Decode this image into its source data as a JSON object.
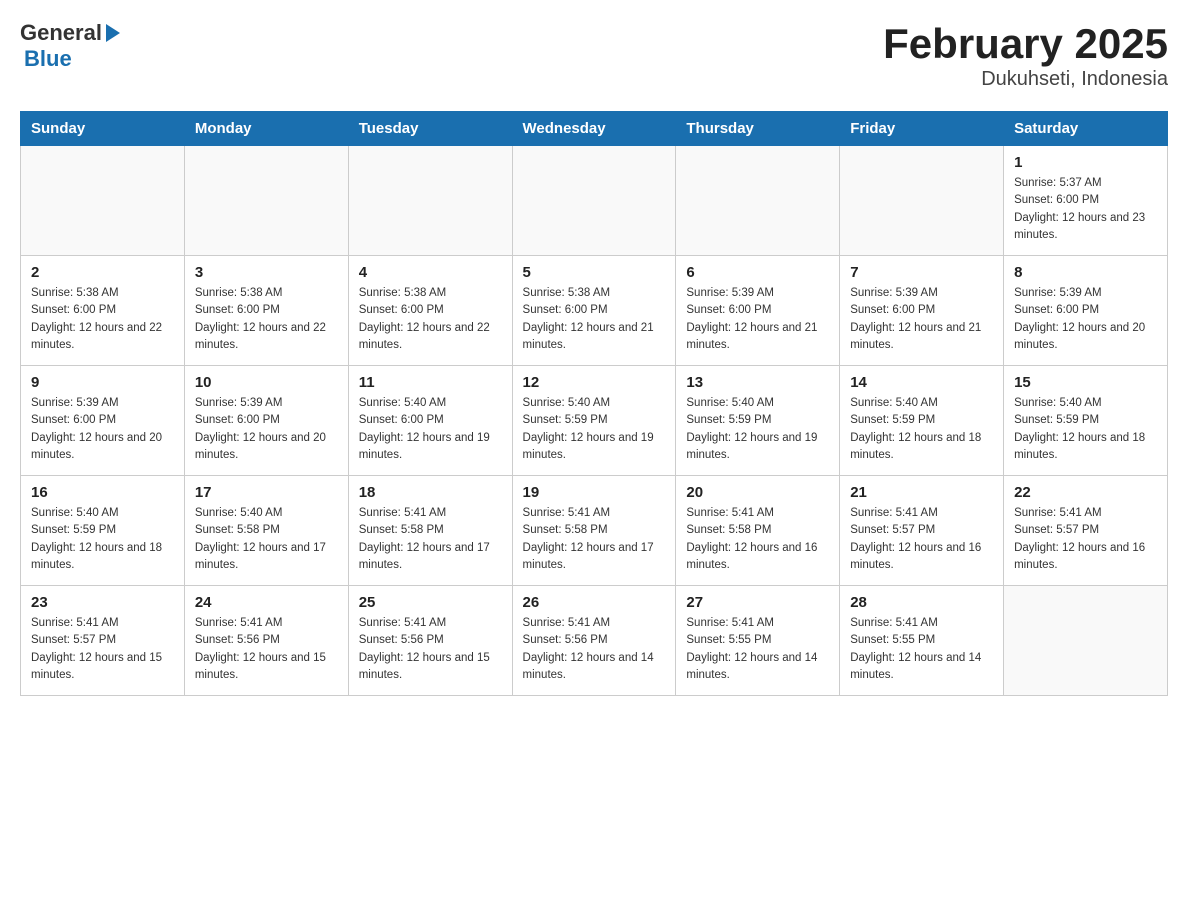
{
  "header": {
    "title": "February 2025",
    "subtitle": "Dukuhseti, Indonesia",
    "logo_general": "General",
    "logo_blue": "Blue"
  },
  "weekdays": [
    "Sunday",
    "Monday",
    "Tuesday",
    "Wednesday",
    "Thursday",
    "Friday",
    "Saturday"
  ],
  "weeks": [
    [
      {
        "day": "",
        "sunrise": "",
        "sunset": "",
        "daylight": ""
      },
      {
        "day": "",
        "sunrise": "",
        "sunset": "",
        "daylight": ""
      },
      {
        "day": "",
        "sunrise": "",
        "sunset": "",
        "daylight": ""
      },
      {
        "day": "",
        "sunrise": "",
        "sunset": "",
        "daylight": ""
      },
      {
        "day": "",
        "sunrise": "",
        "sunset": "",
        "daylight": ""
      },
      {
        "day": "",
        "sunrise": "",
        "sunset": "",
        "daylight": ""
      },
      {
        "day": "1",
        "sunrise": "Sunrise: 5:37 AM",
        "sunset": "Sunset: 6:00 PM",
        "daylight": "Daylight: 12 hours and 23 minutes."
      }
    ],
    [
      {
        "day": "2",
        "sunrise": "Sunrise: 5:38 AM",
        "sunset": "Sunset: 6:00 PM",
        "daylight": "Daylight: 12 hours and 22 minutes."
      },
      {
        "day": "3",
        "sunrise": "Sunrise: 5:38 AM",
        "sunset": "Sunset: 6:00 PM",
        "daylight": "Daylight: 12 hours and 22 minutes."
      },
      {
        "day": "4",
        "sunrise": "Sunrise: 5:38 AM",
        "sunset": "Sunset: 6:00 PM",
        "daylight": "Daylight: 12 hours and 22 minutes."
      },
      {
        "day": "5",
        "sunrise": "Sunrise: 5:38 AM",
        "sunset": "Sunset: 6:00 PM",
        "daylight": "Daylight: 12 hours and 21 minutes."
      },
      {
        "day": "6",
        "sunrise": "Sunrise: 5:39 AM",
        "sunset": "Sunset: 6:00 PM",
        "daylight": "Daylight: 12 hours and 21 minutes."
      },
      {
        "day": "7",
        "sunrise": "Sunrise: 5:39 AM",
        "sunset": "Sunset: 6:00 PM",
        "daylight": "Daylight: 12 hours and 21 minutes."
      },
      {
        "day": "8",
        "sunrise": "Sunrise: 5:39 AM",
        "sunset": "Sunset: 6:00 PM",
        "daylight": "Daylight: 12 hours and 20 minutes."
      }
    ],
    [
      {
        "day": "9",
        "sunrise": "Sunrise: 5:39 AM",
        "sunset": "Sunset: 6:00 PM",
        "daylight": "Daylight: 12 hours and 20 minutes."
      },
      {
        "day": "10",
        "sunrise": "Sunrise: 5:39 AM",
        "sunset": "Sunset: 6:00 PM",
        "daylight": "Daylight: 12 hours and 20 minutes."
      },
      {
        "day": "11",
        "sunrise": "Sunrise: 5:40 AM",
        "sunset": "Sunset: 6:00 PM",
        "daylight": "Daylight: 12 hours and 19 minutes."
      },
      {
        "day": "12",
        "sunrise": "Sunrise: 5:40 AM",
        "sunset": "Sunset: 5:59 PM",
        "daylight": "Daylight: 12 hours and 19 minutes."
      },
      {
        "day": "13",
        "sunrise": "Sunrise: 5:40 AM",
        "sunset": "Sunset: 5:59 PM",
        "daylight": "Daylight: 12 hours and 19 minutes."
      },
      {
        "day": "14",
        "sunrise": "Sunrise: 5:40 AM",
        "sunset": "Sunset: 5:59 PM",
        "daylight": "Daylight: 12 hours and 18 minutes."
      },
      {
        "day": "15",
        "sunrise": "Sunrise: 5:40 AM",
        "sunset": "Sunset: 5:59 PM",
        "daylight": "Daylight: 12 hours and 18 minutes."
      }
    ],
    [
      {
        "day": "16",
        "sunrise": "Sunrise: 5:40 AM",
        "sunset": "Sunset: 5:59 PM",
        "daylight": "Daylight: 12 hours and 18 minutes."
      },
      {
        "day": "17",
        "sunrise": "Sunrise: 5:40 AM",
        "sunset": "Sunset: 5:58 PM",
        "daylight": "Daylight: 12 hours and 17 minutes."
      },
      {
        "day": "18",
        "sunrise": "Sunrise: 5:41 AM",
        "sunset": "Sunset: 5:58 PM",
        "daylight": "Daylight: 12 hours and 17 minutes."
      },
      {
        "day": "19",
        "sunrise": "Sunrise: 5:41 AM",
        "sunset": "Sunset: 5:58 PM",
        "daylight": "Daylight: 12 hours and 17 minutes."
      },
      {
        "day": "20",
        "sunrise": "Sunrise: 5:41 AM",
        "sunset": "Sunset: 5:58 PM",
        "daylight": "Daylight: 12 hours and 16 minutes."
      },
      {
        "day": "21",
        "sunrise": "Sunrise: 5:41 AM",
        "sunset": "Sunset: 5:57 PM",
        "daylight": "Daylight: 12 hours and 16 minutes."
      },
      {
        "day": "22",
        "sunrise": "Sunrise: 5:41 AM",
        "sunset": "Sunset: 5:57 PM",
        "daylight": "Daylight: 12 hours and 16 minutes."
      }
    ],
    [
      {
        "day": "23",
        "sunrise": "Sunrise: 5:41 AM",
        "sunset": "Sunset: 5:57 PM",
        "daylight": "Daylight: 12 hours and 15 minutes."
      },
      {
        "day": "24",
        "sunrise": "Sunrise: 5:41 AM",
        "sunset": "Sunset: 5:56 PM",
        "daylight": "Daylight: 12 hours and 15 minutes."
      },
      {
        "day": "25",
        "sunrise": "Sunrise: 5:41 AM",
        "sunset": "Sunset: 5:56 PM",
        "daylight": "Daylight: 12 hours and 15 minutes."
      },
      {
        "day": "26",
        "sunrise": "Sunrise: 5:41 AM",
        "sunset": "Sunset: 5:56 PM",
        "daylight": "Daylight: 12 hours and 14 minutes."
      },
      {
        "day": "27",
        "sunrise": "Sunrise: 5:41 AM",
        "sunset": "Sunset: 5:55 PM",
        "daylight": "Daylight: 12 hours and 14 minutes."
      },
      {
        "day": "28",
        "sunrise": "Sunrise: 5:41 AM",
        "sunset": "Sunset: 5:55 PM",
        "daylight": "Daylight: 12 hours and 14 minutes."
      },
      {
        "day": "",
        "sunrise": "",
        "sunset": "",
        "daylight": ""
      }
    ]
  ]
}
